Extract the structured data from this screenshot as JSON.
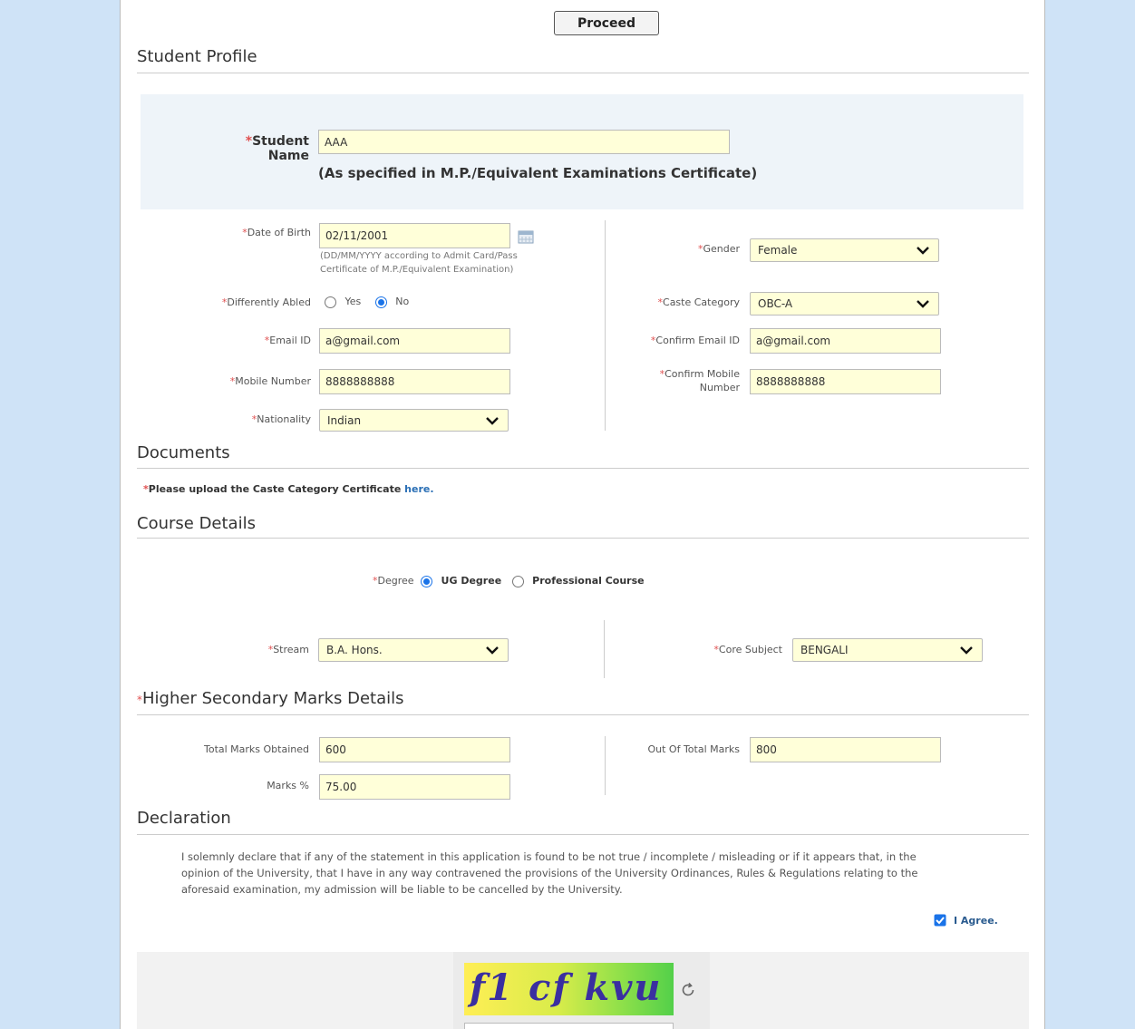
{
  "proceed_label": "Proceed",
  "student_profile": {
    "title": "Student Profile",
    "name_label": "Student Name",
    "name_value": "AAA",
    "name_note": "(As specified in M.P./Equivalent Examinations Certificate)"
  },
  "personal": {
    "dob_label": "Date of Birth",
    "dob_value": "02/11/2001",
    "dob_hint_1": "(DD/MM/YYYY according to Admit Card/Pass",
    "dob_hint_2": "Certificate of M.P./Equivalent Examination)",
    "gender_label": "Gender",
    "gender_value": "Female",
    "abled_label": "Differently Abled",
    "abled_yes": "Yes",
    "abled_no": "No",
    "abled_selected": "No",
    "caste_label": "Caste Category",
    "caste_value": "OBC-A",
    "email_label": "Email ID",
    "email_value": "a@gmail.com",
    "confirm_email_label": "Confirm Email ID",
    "confirm_email_value": "a@gmail.com",
    "mobile_label": "Mobile Number",
    "mobile_value": "8888888888",
    "confirm_mobile_label_1": "Confirm Mobile",
    "confirm_mobile_label_2": "Number",
    "confirm_mobile_value": "8888888888",
    "nationality_label": "Nationality",
    "nationality_value": "Indian"
  },
  "documents": {
    "title": "Documents",
    "upload_text": "Please upload the Caste Category Certificate",
    "upload_link": "here."
  },
  "course": {
    "title": "Course Details",
    "degree_label": "Degree",
    "option_ug": "UG Degree",
    "option_prof": "Professional Course",
    "selected": "UG Degree",
    "stream_label": "Stream",
    "stream_value": "B.A. Hons.",
    "core_label": "Core Subject",
    "core_value": "BENGALI"
  },
  "marks": {
    "title": "Higher Secondary Marks Details",
    "total_label": "Total Marks Obtained",
    "total_value": "600",
    "out_of_label": "Out Of Total Marks",
    "out_of_value": "800",
    "percent_label": "Marks %",
    "percent_value": "75.00"
  },
  "declaration": {
    "title": "Declaration",
    "text_1": "I solemnly declare that if any of the statement in this application is found to be not true / incomplete / misleading or if it appears that, in the",
    "text_2": "opinion of the University, that I have in any way contravened the provisions of the University Ordinances, Rules & Regulations relating to the",
    "text_3": "aforesaid examination, my admission will be liable to be cancelled by the University.",
    "agree_label": "I Agree.",
    "agree_checked": true
  },
  "captcha": {
    "text": "f1 cf kvu"
  },
  "colors": {
    "background": "#cfe3f7",
    "input_bg": "#ffffd9",
    "required": "#e05050",
    "link": "#2a6fb5"
  }
}
